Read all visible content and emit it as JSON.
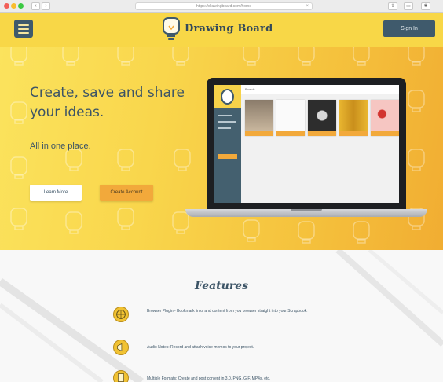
{
  "browser": {
    "url": "https://drawingboard.com/home",
    "back_label": "‹",
    "forward_label": "›",
    "reload_label": "×",
    "share_label": "⇪",
    "tabs_label": "▭",
    "extension_label": "✱"
  },
  "header": {
    "brand": "Drawing Board",
    "signin_label": "Sign In"
  },
  "hero": {
    "title": "Create, save and share your ideas.",
    "subtitle": "All in one place.",
    "learn_more_label": "Learn More",
    "create_account_label": "Create Account"
  },
  "screen": {
    "toolbar_text": "Boards"
  },
  "features": {
    "title": "Features",
    "items": [
      {
        "icon": "globe-icon",
        "text": "Browser Plugin - Bookmark links and content from you browser straight into your Scrapbook."
      },
      {
        "icon": "megaphone-icon",
        "text": "Audio Notes: Record and attach voice memos to your project."
      },
      {
        "icon": "document-icon",
        "text": "Multiple Formats: Create and post content in 3.0, PNG, GIF, MP4s, etc."
      }
    ]
  },
  "colors": {
    "accent_yellow": "#f8d747",
    "accent_orange": "#f2a93b",
    "dark_slate": "#3f5a6c"
  }
}
